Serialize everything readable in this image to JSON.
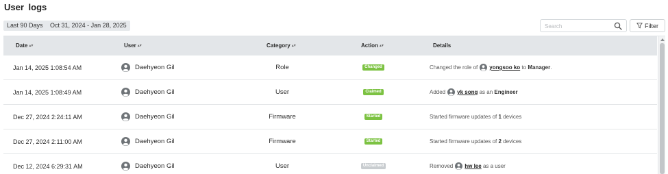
{
  "page": {
    "title": "User logs"
  },
  "toolbar": {
    "range_label": "Last 90 Days",
    "range_dates": "Oct 31, 2024 - Jan 28, 2025",
    "search_placeholder": "Search",
    "search_value": "",
    "filter_label": "Filter"
  },
  "table": {
    "columns": {
      "date": "Date",
      "user": "User",
      "category": "Category",
      "action": "Action",
      "details": "Details"
    },
    "sortable_columns": [
      "Date",
      "User",
      "Category",
      "Action"
    ],
    "rows": [
      {
        "date": "Jan 14, 2025 1:08:54 AM",
        "user": "Daehyeon Gil",
        "category": "Role",
        "action": "Changed",
        "action_color": "#7cc242",
        "details": {
          "pre": "Changed the role of",
          "target": "yongsoo ko",
          "mid": "to",
          "value": "Manager",
          "post": "."
        }
      },
      {
        "date": "Jan 14, 2025 1:08:49 AM",
        "user": "Daehyeon Gil",
        "category": "User",
        "action": "Claimed",
        "action_color": "#7cc242",
        "details": {
          "pre": "Added",
          "target": "yk song",
          "mid": "as an",
          "value": "Engineer"
        }
      },
      {
        "date": "Dec 27, 2024 2:24:11 AM",
        "user": "Daehyeon Gil",
        "category": "Firmware",
        "action": "Started",
        "action_color": "#7cc242",
        "details": {
          "pre": "Started firmware updates of",
          "value": "1",
          "post": "devices"
        }
      },
      {
        "date": "Dec 27, 2024 2:11:00 AM",
        "user": "Daehyeon Gil",
        "category": "Firmware",
        "action": "Started",
        "action_color": "#7cc242",
        "details": {
          "pre": "Started firmware updates of",
          "value": "2",
          "post": "devices"
        }
      },
      {
        "date": "Dec 12, 2024 6:29:31 AM",
        "user": "Daehyeon Gil",
        "category": "User",
        "action": "Unclaimed",
        "action_color": "#c9cdd0",
        "details": {
          "pre": "Removed",
          "target": "hw lee",
          "post": "as a user"
        }
      }
    ]
  },
  "icons": {
    "search": "search-icon",
    "filter": "filter-icon",
    "avatar": "user-avatar-icon",
    "sort": "sort-icon"
  }
}
